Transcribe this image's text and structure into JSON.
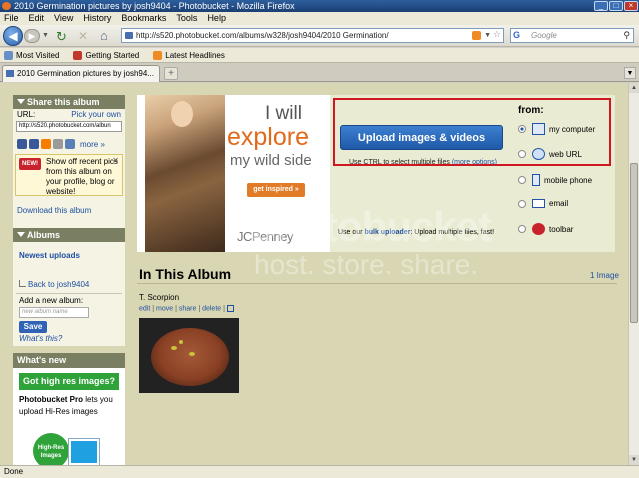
{
  "window": {
    "title": "2010 Germination pictures by josh9404 - Photobucket - Mozilla Firefox"
  },
  "menu": [
    "File",
    "Edit",
    "View",
    "History",
    "Bookmarks",
    "Tools",
    "Help"
  ],
  "nav": {
    "url": "http://s520.photobucket.com/albums/w328/josh9404/2010 Germination/",
    "search_placeholder": "Google",
    "search_engine": "G"
  },
  "bookmarks": [
    {
      "label": "Most Visited",
      "color": "#6a8fc8"
    },
    {
      "label": "Getting Started",
      "color": "#c0392b"
    },
    {
      "label": "Latest Headlines",
      "color": "#f08a24"
    }
  ],
  "tab": {
    "label": "2010 Germination pictures by josh94..."
  },
  "status": "Done",
  "sidebar": {
    "share": {
      "title": "Share this album",
      "url_label": "URL:",
      "pick_link": "Pick your own",
      "url_value": "http://s520.photobucket.com/albun",
      "more": "more »",
      "new_badge": "NEW!",
      "new_text": "Show off recent pics from this album on your profile, blog or website!",
      "download": "Download this album"
    },
    "albums": {
      "title": "Albums",
      "newest": "Newest uploads",
      "back": "Back to josh9404",
      "add_label": "Add a new album:",
      "input_placeholder": "new album name",
      "save": "Save",
      "what": "What's this?"
    },
    "whats_new": {
      "title": "What's new",
      "button": "Got high res images?",
      "text_bold": "Photobucket Pro",
      "text_rest": " lets you upload Hi-Res images",
      "badge": "High-Res Images"
    }
  },
  "ad": {
    "line1": "I will",
    "line2": "explore",
    "line3": "my wild side",
    "button": "get inspired »",
    "brand": "JCPenney"
  },
  "upload": {
    "button": "Upload images & videos",
    "note": "Use CTRL to select multiple files",
    "more_options": "(more options)",
    "from": "from:",
    "sources": [
      {
        "label": "my computer",
        "selected": true,
        "icon": "monitor-icon"
      },
      {
        "label": "web URL",
        "selected": false,
        "icon": "globe-icon"
      },
      {
        "label": "mobile phone",
        "selected": false,
        "icon": "phone-icon"
      },
      {
        "label": "email",
        "selected": false,
        "icon": "envelope-icon"
      },
      {
        "label": "toolbar",
        "selected": false,
        "icon": "ask-icon"
      }
    ],
    "bulk_prefix": "Use our ",
    "bulk_link": "bulk uploader",
    "bulk_suffix": ": Upload multiple files, fast!"
  },
  "album": {
    "title": "In This Album",
    "count": "1 Image",
    "caption": "T. Scorpion",
    "actions": [
      "edit",
      "move",
      "share",
      "delete"
    ]
  },
  "watermark": {
    "line1": "photobucket",
    "line2": "host. store. share."
  }
}
